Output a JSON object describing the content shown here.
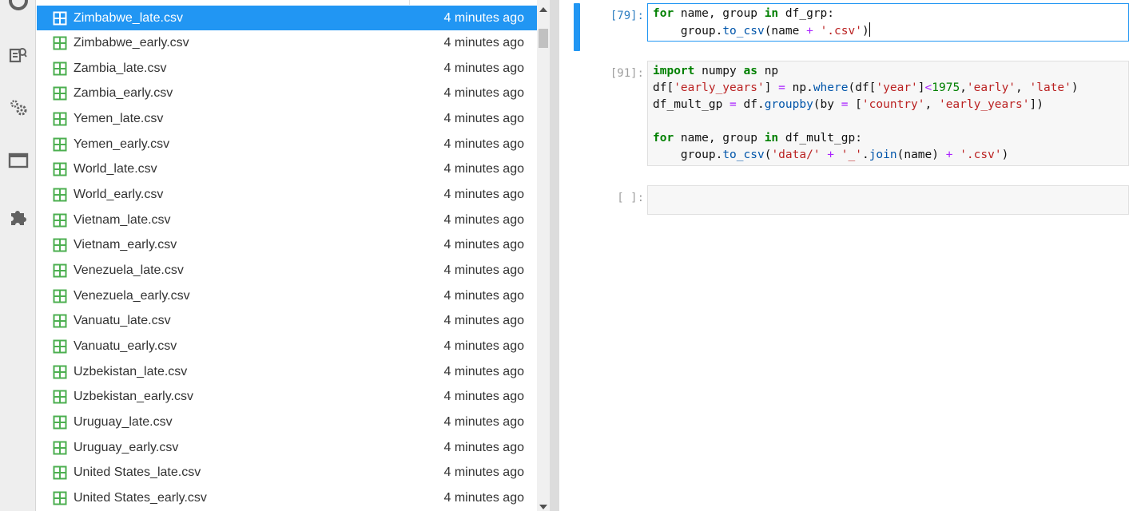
{
  "activity_bar": {
    "icons": [
      "running-icon",
      "property-inspector-icon",
      "settings-gears-icon",
      "tabs-icon",
      "extension-puzzle-icon"
    ]
  },
  "file_browser": {
    "files": [
      {
        "name": "Zimbabwe_late.csv",
        "modified": "4 minutes ago",
        "selected": true
      },
      {
        "name": "Zimbabwe_early.csv",
        "modified": "4 minutes ago"
      },
      {
        "name": "Zambia_late.csv",
        "modified": "4 minutes ago"
      },
      {
        "name": "Zambia_early.csv",
        "modified": "4 minutes ago"
      },
      {
        "name": "Yemen_late.csv",
        "modified": "4 minutes ago"
      },
      {
        "name": "Yemen_early.csv",
        "modified": "4 minutes ago"
      },
      {
        "name": "World_late.csv",
        "modified": "4 minutes ago"
      },
      {
        "name": "World_early.csv",
        "modified": "4 minutes ago"
      },
      {
        "name": "Vietnam_late.csv",
        "modified": "4 minutes ago"
      },
      {
        "name": "Vietnam_early.csv",
        "modified": "4 minutes ago"
      },
      {
        "name": "Venezuela_late.csv",
        "modified": "4 minutes ago"
      },
      {
        "name": "Venezuela_early.csv",
        "modified": "4 minutes ago"
      },
      {
        "name": "Vanuatu_late.csv",
        "modified": "4 minutes ago"
      },
      {
        "name": "Vanuatu_early.csv",
        "modified": "4 minutes ago"
      },
      {
        "name": "Uzbekistan_late.csv",
        "modified": "4 minutes ago"
      },
      {
        "name": "Uzbekistan_early.csv",
        "modified": "4 minutes ago"
      },
      {
        "name": "Uruguay_late.csv",
        "modified": "4 minutes ago"
      },
      {
        "name": "Uruguay_early.csv",
        "modified": "4 minutes ago"
      },
      {
        "name": "United States_late.csv",
        "modified": "4 minutes ago"
      },
      {
        "name": "United States_early.csv",
        "modified": "4 minutes ago"
      }
    ],
    "file_icon": "spreadsheet-grid-icon",
    "selected_color": "#2196f3",
    "file_icon_color": "#4caf50"
  },
  "notebook": {
    "cells": [
      {
        "prompt": "[79]:",
        "active": true,
        "lines": [
          [
            [
              "kw",
              "for"
            ],
            [
              "t",
              " name, group "
            ],
            [
              "kw",
              "in"
            ],
            [
              "t",
              " df_grp:"
            ]
          ],
          [
            [
              "t",
              "    group."
            ],
            [
              "fn",
              "to_csv"
            ],
            [
              "t",
              "(name "
            ],
            [
              "op",
              "+"
            ],
            [
              "t",
              " "
            ],
            [
              "st",
              "'.csv'"
            ],
            [
              "t",
              ")"
            ],
            [
              "cursor",
              ""
            ]
          ]
        ]
      },
      {
        "prompt": "[91]:",
        "active": false,
        "lines": [
          [
            [
              "kw",
              "import"
            ],
            [
              "t",
              " numpy "
            ],
            [
              "kw",
              "as"
            ],
            [
              "t",
              " np"
            ]
          ],
          [
            [
              "t",
              "df["
            ],
            [
              "st",
              "'early_years'"
            ],
            [
              "t",
              "] "
            ],
            [
              "op",
              "="
            ],
            [
              "t",
              " np."
            ],
            [
              "fn",
              "where"
            ],
            [
              "t",
              "(df["
            ],
            [
              "st",
              "'year'"
            ],
            [
              "t",
              "]"
            ],
            [
              "op",
              "<"
            ],
            [
              "nm",
              "1975"
            ],
            [
              "t",
              ","
            ],
            [
              "st",
              "'early'"
            ],
            [
              "t",
              ", "
            ],
            [
              "st",
              "'late'"
            ],
            [
              "t",
              ")"
            ]
          ],
          [
            [
              "t",
              "df_mult_gp "
            ],
            [
              "op",
              "="
            ],
            [
              "t",
              " df."
            ],
            [
              "fn",
              "groupby"
            ],
            [
              "t",
              "(by "
            ],
            [
              "op",
              "="
            ],
            [
              "t",
              " ["
            ],
            [
              "st",
              "'country'"
            ],
            [
              "t",
              ", "
            ],
            [
              "st",
              "'early_years'"
            ],
            [
              "t",
              "])"
            ]
          ],
          [
            [
              "t",
              ""
            ]
          ],
          [
            [
              "kw",
              "for"
            ],
            [
              "t",
              " name, group "
            ],
            [
              "kw",
              "in"
            ],
            [
              "t",
              " df_mult_gp:"
            ]
          ],
          [
            [
              "t",
              "    group."
            ],
            [
              "fn",
              "to_csv"
            ],
            [
              "t",
              "("
            ],
            [
              "st",
              "'data/'"
            ],
            [
              "t",
              " "
            ],
            [
              "op",
              "+"
            ],
            [
              "t",
              " "
            ],
            [
              "st",
              "'_'"
            ],
            [
              "t",
              "."
            ],
            [
              "fn",
              "join"
            ],
            [
              "t",
              "(name) "
            ],
            [
              "op",
              "+"
            ],
            [
              "t",
              " "
            ],
            [
              "st",
              "'.csv'"
            ],
            [
              "t",
              ")"
            ]
          ]
        ]
      },
      {
        "prompt": "[ ]:",
        "active": false,
        "lines": [
          [
            [
              "t",
              ""
            ]
          ]
        ]
      }
    ]
  }
}
